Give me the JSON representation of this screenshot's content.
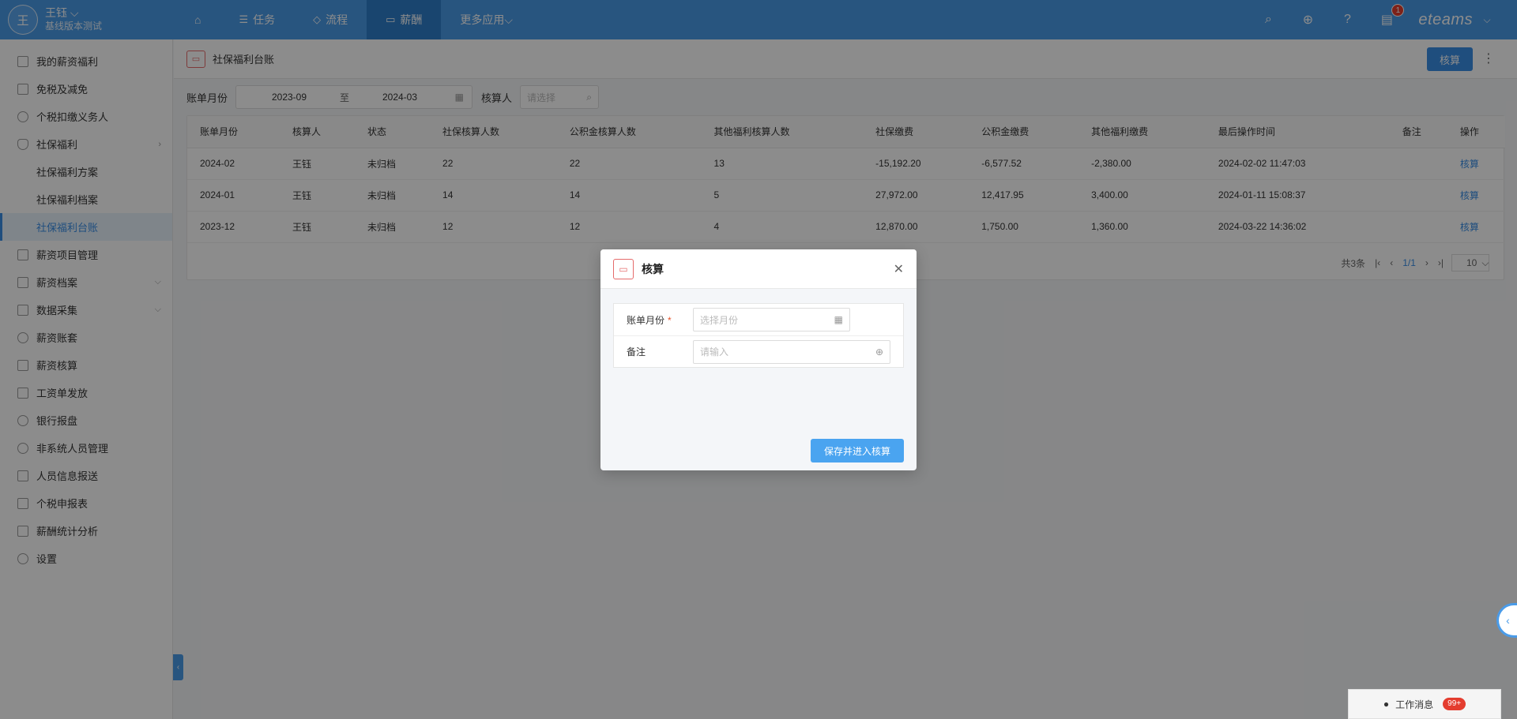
{
  "user": {
    "avatar": "王",
    "name": "王钰",
    "sub": "基线版本测试"
  },
  "nav": [
    {
      "label": "任务",
      "icon": "list-icon"
    },
    {
      "label": "流程",
      "icon": "flow-icon"
    },
    {
      "label": "薪酬",
      "icon": "money-icon"
    },
    {
      "label": "更多应用",
      "icon": "chevron-down-icon"
    }
  ],
  "topbar": {
    "notif_count": "1",
    "brand": "eteams"
  },
  "sidebar": {
    "items": [
      {
        "label": "我的薪资福利"
      },
      {
        "label": "免税及减免"
      },
      {
        "label": "个税扣缴义务人"
      },
      {
        "label": "社保福利"
      },
      {
        "label": "社保福利方案"
      },
      {
        "label": "社保福利档案"
      },
      {
        "label": "社保福利台账"
      },
      {
        "label": "薪资项目管理"
      },
      {
        "label": "薪资档案"
      },
      {
        "label": "数据采集"
      },
      {
        "label": "薪资账套"
      },
      {
        "label": "薪资核算"
      },
      {
        "label": "工资单发放"
      },
      {
        "label": "银行报盘"
      },
      {
        "label": "非系统人员管理"
      },
      {
        "label": "人员信息报送"
      },
      {
        "label": "个税申报表"
      },
      {
        "label": "薪酬统计分析"
      },
      {
        "label": "设置"
      }
    ]
  },
  "page": {
    "title": "社保福利台账",
    "action_label": "核算"
  },
  "filter": {
    "month_label": "账单月份",
    "from": "2023-09",
    "to_sep": "至",
    "to": "2024-03",
    "person_label": "核算人",
    "person_placeholder": "请选择"
  },
  "table": {
    "headers": [
      "账单月份",
      "核算人",
      "状态",
      "社保核算人数",
      "公积金核算人数",
      "其他福利核算人数",
      "社保缴费",
      "公积金缴费",
      "其他福利缴费",
      "最后操作时间",
      "备注",
      "操作"
    ],
    "rows": [
      [
        "2024-02",
        "王钰",
        "未归档",
        "22",
        "22",
        "13",
        "-15,192.20",
        "-6,577.52",
        "-2,380.00",
        "2024-02-02 11:47:03",
        "",
        "核算"
      ],
      [
        "2024-01",
        "王钰",
        "未归档",
        "14",
        "14",
        "5",
        "27,972.00",
        "12,417.95",
        "3,400.00",
        "2024-01-11 15:08:37",
        "",
        "核算"
      ],
      [
        "2023-12",
        "王钰",
        "未归档",
        "12",
        "12",
        "4",
        "12,870.00",
        "1,750.00",
        "1,360.00",
        "2024-03-22 14:36:02",
        "",
        "核算"
      ]
    ]
  },
  "pager": {
    "total": "共3条",
    "page": "1/1",
    "size": "10"
  },
  "modal": {
    "title": "核算",
    "month_label": "账单月份",
    "month_placeholder": "选择月份",
    "note_label": "备注",
    "note_placeholder": "请输入",
    "submit_label": "保存并进入核算"
  },
  "messages": {
    "label": "工作消息",
    "count": "99+"
  },
  "colors": {
    "primary": "#4a9be8",
    "accent": "#3a8ee6",
    "danger": "#e43d2f"
  }
}
